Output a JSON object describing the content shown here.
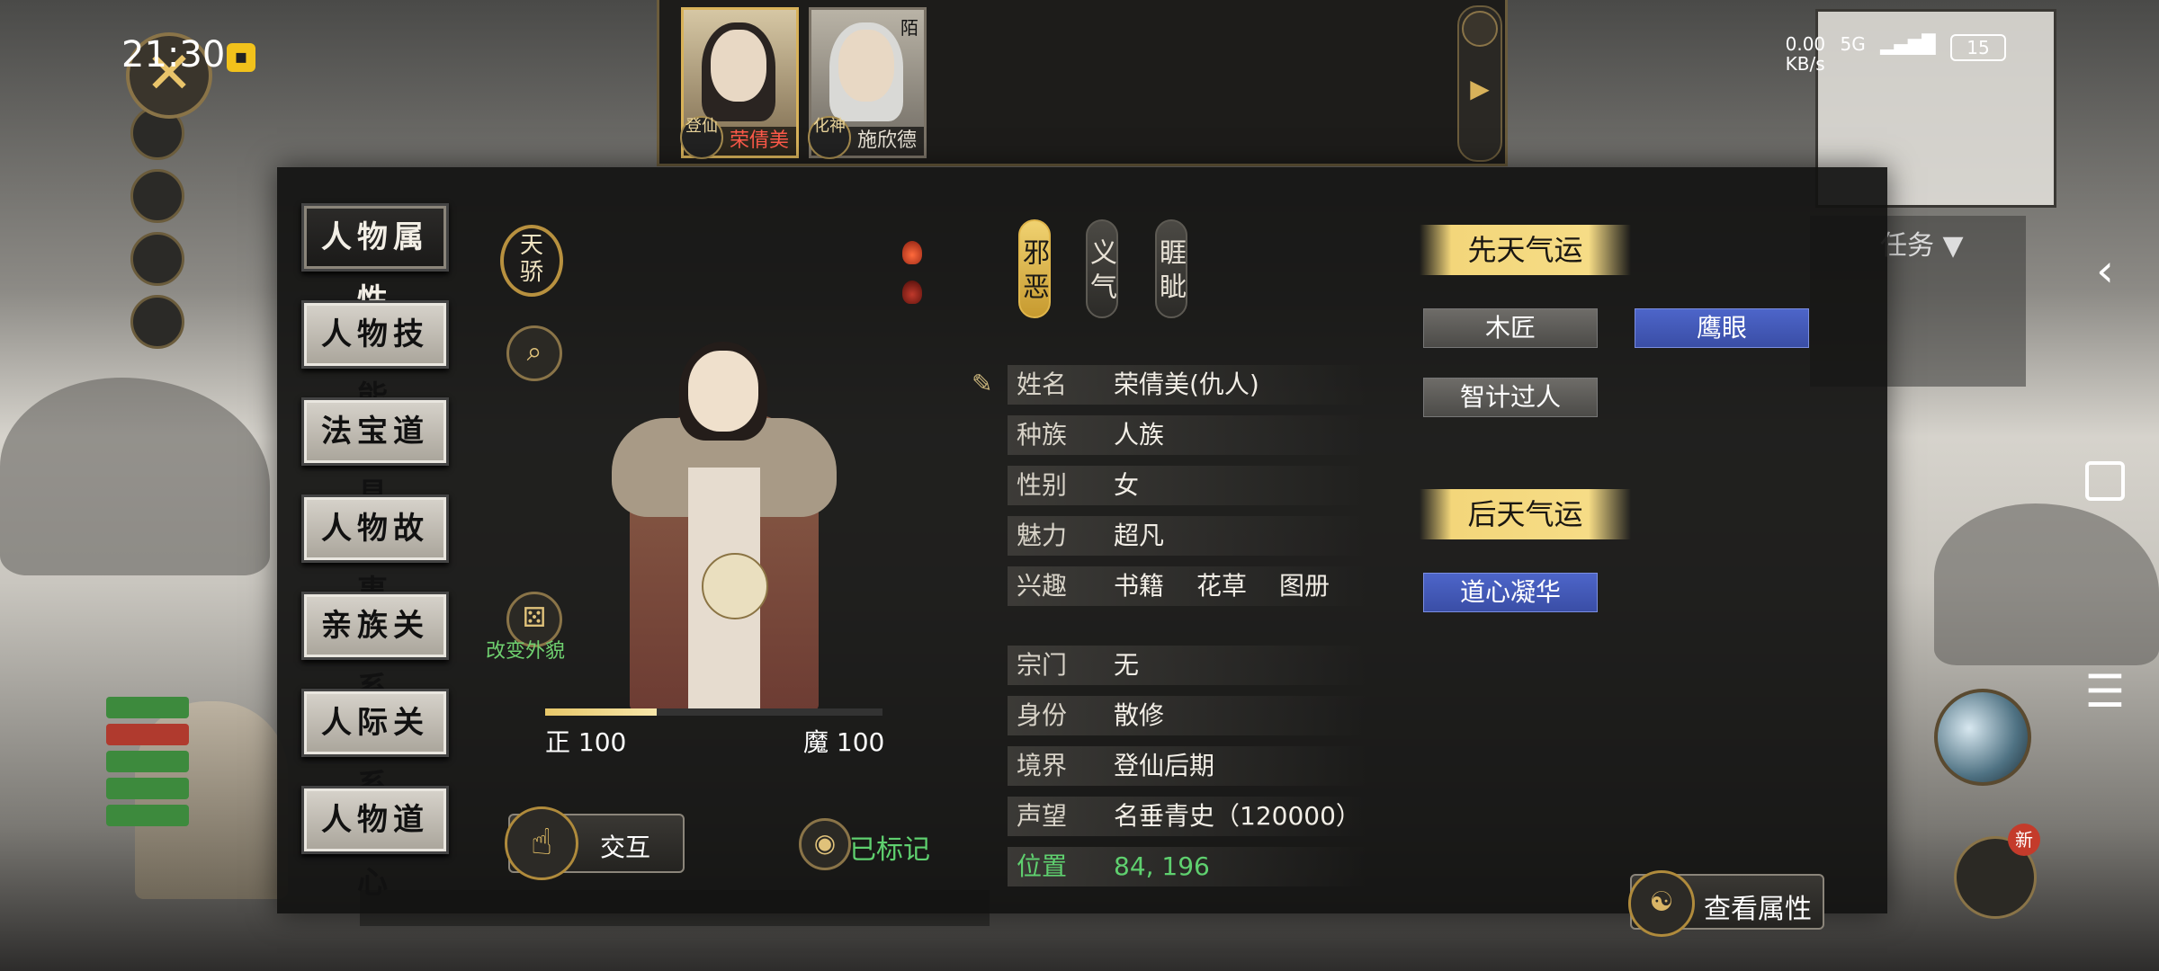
{
  "status": {
    "time": "21:30",
    "net_speed": "0.00",
    "net_unit": "KB/s",
    "network": "5G",
    "battery": "15"
  },
  "party": [
    {
      "name": "荣倩美",
      "rank": "登仙",
      "selected": true
    },
    {
      "name": "施欣德",
      "rank": "化神",
      "tag": "陌",
      "selected": false
    }
  ],
  "tabs": [
    "人物属性",
    "人物技能",
    "法宝道具",
    "人物故事",
    "亲族关系",
    "人际关系",
    "人物道心"
  ],
  "active_tab": 0,
  "badge": {
    "title_line1": "天",
    "title_line2": "骄"
  },
  "change_appearance": "改变外貌",
  "morality": {
    "zheng_label": "正 100",
    "mo_label": "魔 100",
    "zheng_fraction": 0.33
  },
  "alignment": [
    {
      "label": "邪恶",
      "active": true
    },
    {
      "label": "义气",
      "active": false
    },
    {
      "label": "睚眦",
      "active": false
    }
  ],
  "info": {
    "name_k": "姓名",
    "name_v": "荣倩美(仇人)",
    "race_k": "种族",
    "race_v": "人族",
    "gender_k": "性别",
    "gender_v": "女",
    "charm_k": "魅力",
    "charm_v": "超凡",
    "hobby_k": "兴趣",
    "hobbies": [
      "书籍",
      "花草",
      "图册"
    ],
    "sect_k": "宗门",
    "sect_v": "无",
    "identity_k": "身份",
    "identity_v": "散修",
    "realm_k": "境界",
    "realm_v": "登仙后期",
    "fame_k": "声望",
    "fame_v": "名垂青史（120000）",
    "pos_k": "位置",
    "pos_v": "84, 196"
  },
  "innate_luck": {
    "title": "先天气运",
    "traits": [
      {
        "label": "木匠",
        "color": "grey"
      },
      {
        "label": "鹰眼",
        "color": "blue"
      },
      {
        "label": "智计过人",
        "color": "grey"
      }
    ]
  },
  "acquired_luck": {
    "title": "后天气运",
    "traits": [
      {
        "label": "道心凝华",
        "color": "blue"
      }
    ]
  },
  "buttons": {
    "interact": "交互",
    "marked": "已标记",
    "view_attr": "查看属性"
  },
  "background": {
    "task_label": "任务",
    "mail_badge": "新"
  },
  "colors": {
    "accent_gold": "#d8b25a",
    "enemy_red": "#ff5a4a",
    "green": "#5fd06f",
    "trait_blue": "#4d65c9"
  }
}
